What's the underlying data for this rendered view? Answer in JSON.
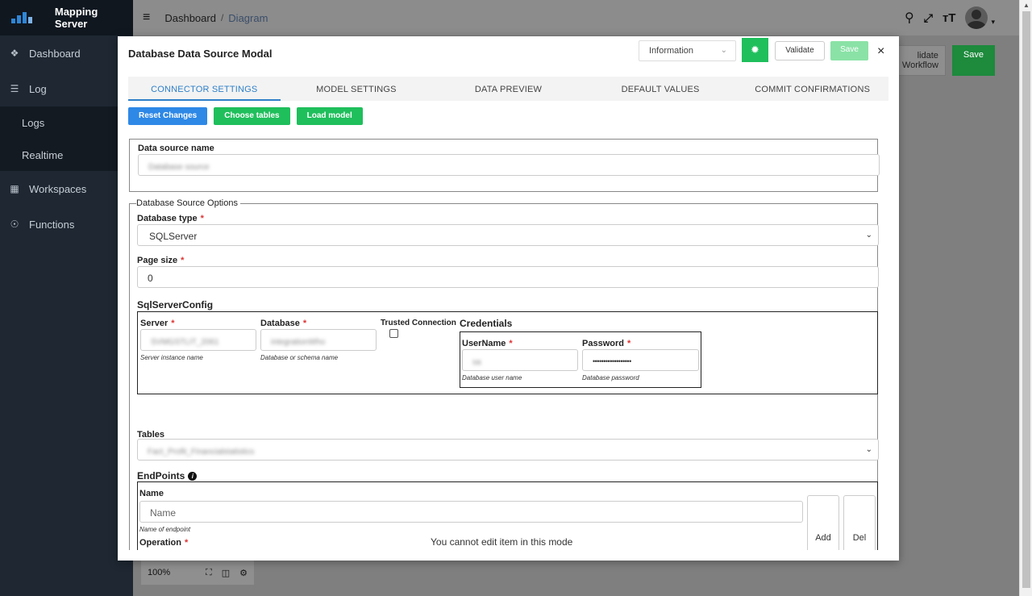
{
  "app": {
    "brand": "Mapping Server",
    "breadcrumb": {
      "home": "Dashboard",
      "separator": "/",
      "current": "Diagram"
    }
  },
  "sidebar": {
    "items": [
      {
        "label": "Dashboard",
        "icon": "palette-icon"
      },
      {
        "label": "Log",
        "icon": "list-icon"
      },
      {
        "label": "Logs"
      },
      {
        "label": "Realtime"
      },
      {
        "label": "Workspaces",
        "icon": "grid-icon"
      },
      {
        "label": "Functions",
        "icon": "function-icon"
      }
    ]
  },
  "background": {
    "validate_workflow": "lidate Workflow",
    "save": "Save",
    "zoom": "100%"
  },
  "modal": {
    "title": "Database Data Source Modal",
    "info_select": "Information",
    "validate": "Validate",
    "save": "Save",
    "close": "×",
    "tabs": [
      "CONNECTOR SETTINGS",
      "MODEL SETTINGS",
      "DATA PREVIEW",
      "DEFAULT VALUES",
      "COMMIT CONFIRMATIONS"
    ],
    "actions": {
      "reset": "Reset Changes",
      "choose_tables": "Choose tables",
      "load_model": "Load model"
    },
    "data_source": {
      "label": "Data source name",
      "value": "Database source"
    },
    "options": {
      "legend": "Database Source Options",
      "db_type": {
        "label": "Database type",
        "required": "*",
        "value": "SQLServer"
      },
      "page_size": {
        "label": "Page size",
        "required": "*",
        "value": "0"
      },
      "sqlserver_config": "SqlServerConfig",
      "server": {
        "label": "Server",
        "required": "*",
        "value": "SVMGSTLIT_2061",
        "hint": "Server instance name"
      },
      "database": {
        "label": "Database",
        "required": "*",
        "value": "integrationWho",
        "hint": "Database or schema name"
      },
      "trusted": {
        "label": "Trusted Connection",
        "checked": false
      },
      "credentials": {
        "title": "Credentials",
        "username": {
          "label": "UserName",
          "required": "*",
          "value": "sa",
          "hint": "Database user name"
        },
        "password": {
          "label": "Password",
          "required": "*",
          "value": "••••••••••••••••••",
          "hint": "Database password"
        }
      },
      "tables": {
        "label": "Tables",
        "value": "Fact_Profit_Financialstatistics"
      },
      "endpoints": {
        "title": "EndPoints",
        "name": {
          "label": "Name",
          "placeholder": "Name",
          "hint": "Name of endpoint"
        },
        "operation": {
          "label": "Operation",
          "required": "*"
        },
        "add": "Add",
        "del": "Del"
      }
    },
    "readonly_message": "You cannot edit item in this mode"
  }
}
